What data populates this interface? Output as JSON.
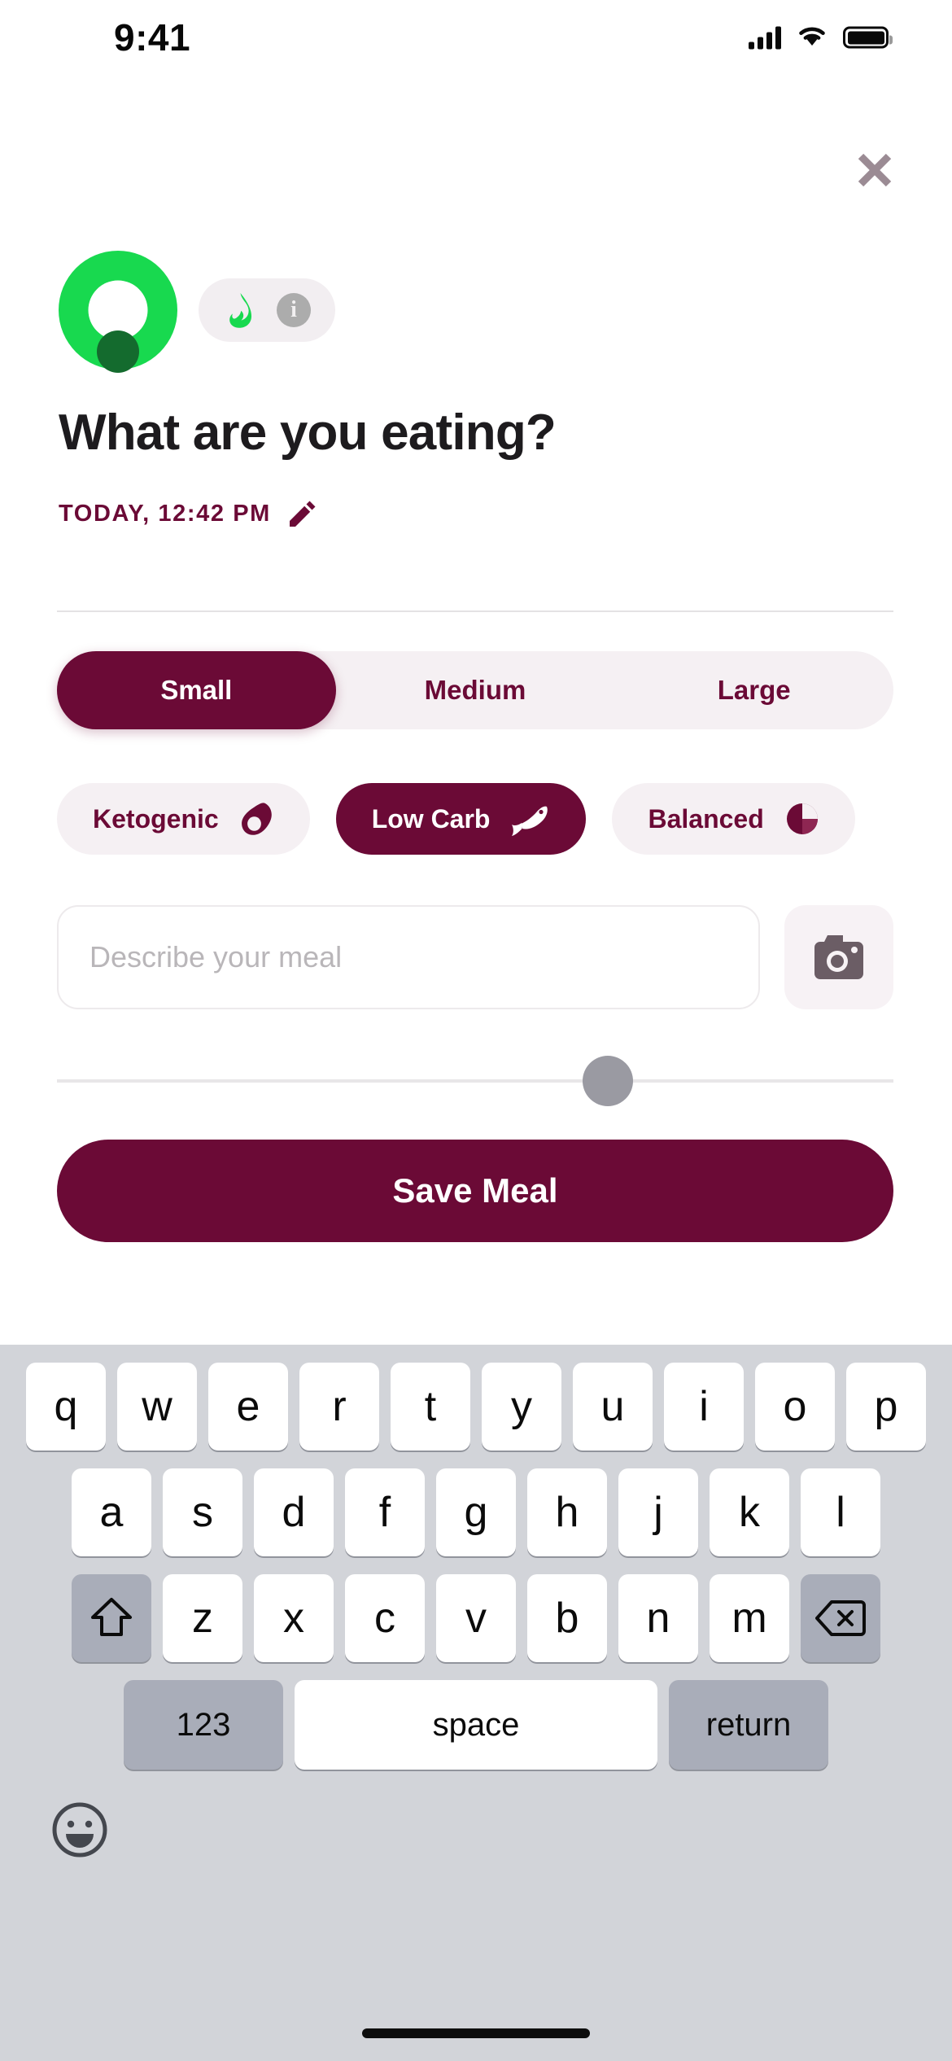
{
  "status_bar": {
    "time": "9:41",
    "signal_icon": "cellular-signal-icon",
    "wifi_icon": "wifi-icon",
    "battery_icon": "battery-icon"
  },
  "header": {
    "close_icon": "close-icon",
    "progress_ring": {
      "icon": "progress-ring",
      "ring_color": "#18D94F",
      "marker_color": "#146B2E"
    },
    "macro_badge": {
      "flame_icon": "flame-icon",
      "flame_color": "#18D94F",
      "info_icon": "info-icon",
      "info_label": "i",
      "background": "#F2EEF1"
    }
  },
  "main": {
    "title": "What are you eating?",
    "date": "TODAY, 12:42 PM",
    "edit_icon": "pencil-icon",
    "edit_icon_color": "#6B0A36"
  },
  "size_segment": {
    "selected": "Small",
    "options": [
      {
        "label": "Small",
        "selected": true
      },
      {
        "label": "Medium",
        "selected": false
      },
      {
        "label": "Large",
        "selected": false
      }
    ],
    "active_color": "#6B0A36",
    "track_color": "#F5F0F3"
  },
  "diet_chips": {
    "selected": "Low Carb",
    "items": [
      {
        "label": "Ketogenic",
        "icon": "avocado-icon",
        "selected": false
      },
      {
        "label": "Low Carb",
        "icon": "fish-icon",
        "selected": true
      },
      {
        "label": "Balanced",
        "icon": "pie-chart-icon",
        "selected": false
      }
    ]
  },
  "meal_input": {
    "placeholder": "Describe your meal",
    "value": "",
    "camera_icon": "camera-icon"
  },
  "slider": {
    "handle_icon": "slider-handle",
    "handle_color": "#9A9AA2",
    "track_color": "#E8E6E8"
  },
  "save": {
    "label": "Save Meal",
    "background": "#6B0A36"
  },
  "keyboard": {
    "row1": [
      "q",
      "w",
      "e",
      "r",
      "t",
      "y",
      "u",
      "i",
      "o",
      "p"
    ],
    "row2": [
      "a",
      "s",
      "d",
      "f",
      "g",
      "h",
      "j",
      "k",
      "l"
    ],
    "row3": [
      "z",
      "x",
      "c",
      "v",
      "b",
      "n",
      "m"
    ],
    "shift_icon": "shift-icon",
    "backspace_icon": "backspace-icon",
    "numbers_label": "123",
    "space_label": "space",
    "return_label": "return",
    "emoji_icon": "emoji-icon"
  }
}
